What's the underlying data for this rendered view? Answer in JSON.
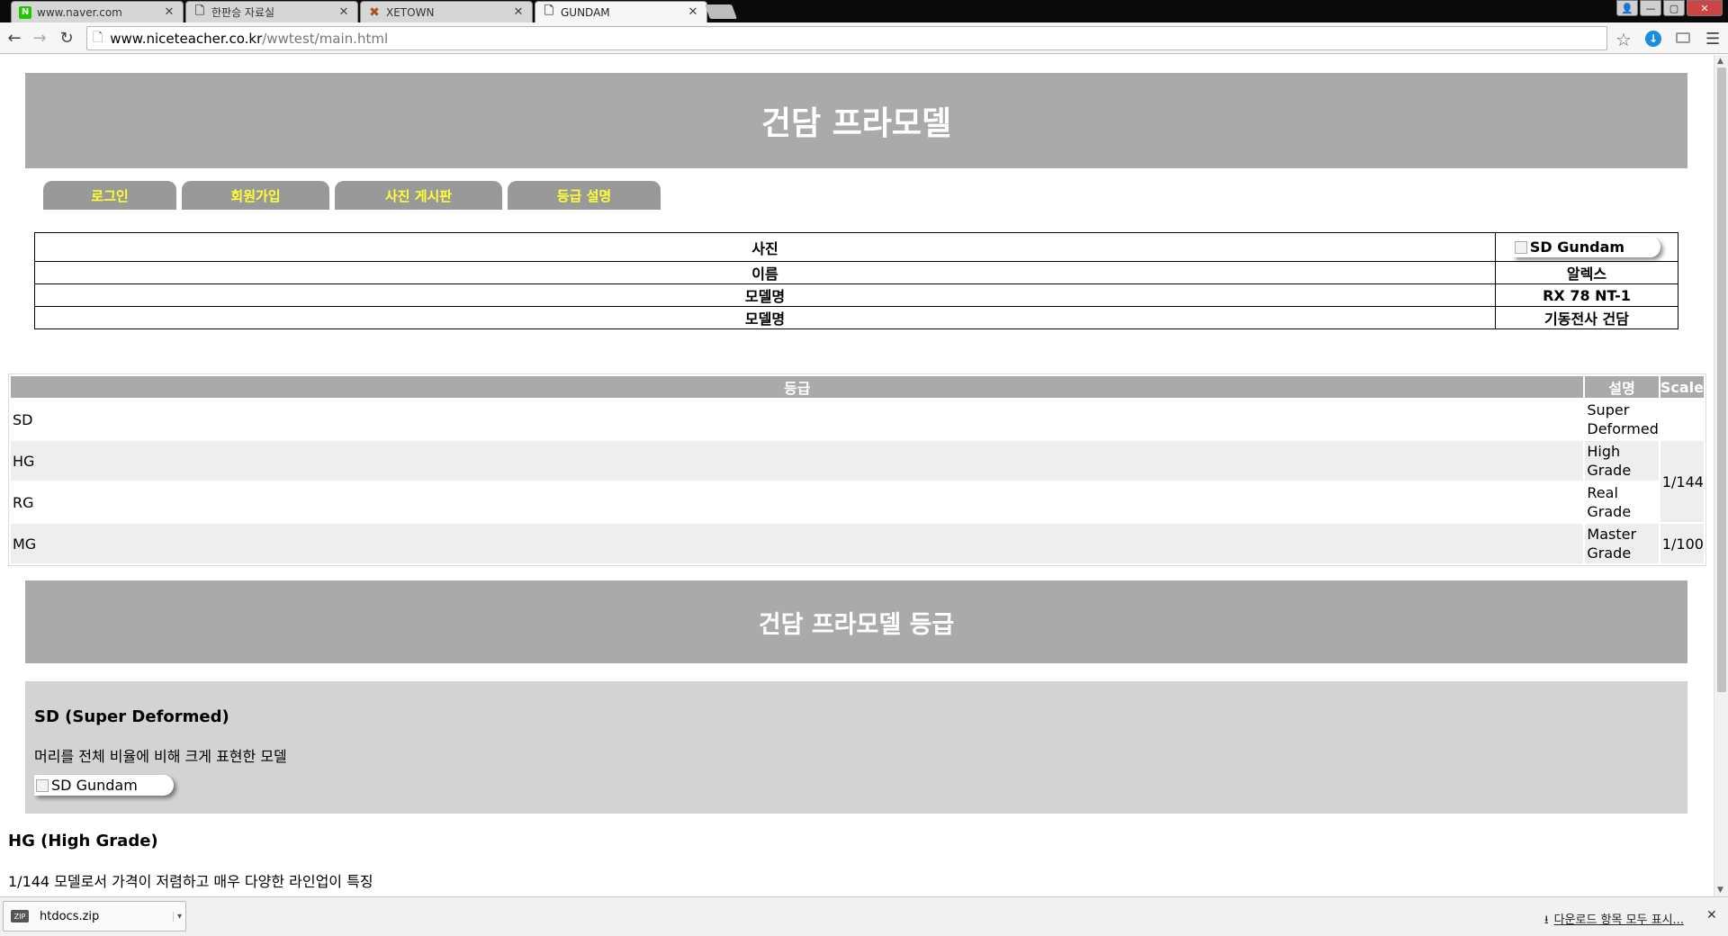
{
  "tabs": [
    {
      "label": "www.naver.com",
      "icon": "naver-favicon"
    },
    {
      "label": "한판승 자료실",
      "icon": "document-favicon"
    },
    {
      "label": "XETOWN",
      "icon": "xetown-favicon"
    },
    {
      "label": "GUNDAM",
      "icon": "document-favicon",
      "active": true
    }
  ],
  "address": {
    "host": "www.niceteacher.co.kr",
    "path": "/wwtest/main.html"
  },
  "page": {
    "title": "건담 프라모델",
    "nav": [
      "로그인",
      "회원가입",
      "사진 게시판",
      "등급 설명"
    ],
    "info": {
      "rows": [
        {
          "label": "사진",
          "value": "SD Gundam"
        },
        {
          "label": "이름",
          "value": "알렉스"
        },
        {
          "label": "모델명",
          "value": "RX 78 NT-1"
        },
        {
          "label": "모델명",
          "value": "기동전사 건담"
        }
      ]
    },
    "grades": {
      "headers": [
        "등급",
        "설명",
        "Scale"
      ],
      "rows": [
        {
          "grade": "SD",
          "desc": "Super Deformed",
          "scale": ""
        },
        {
          "grade": "HG",
          "desc": "High Grade",
          "scale": "1/144"
        },
        {
          "grade": "RG",
          "desc": "Real Grade",
          "scale": ""
        },
        {
          "grade": "MG",
          "desc": "Master Grade",
          "scale": "1/100"
        }
      ]
    },
    "grade_title": "건담 프라모델 등급",
    "sd_section": {
      "heading": "SD (Super Deformed)",
      "text": "머리를 전체 비율에 비해 크게 표현한 모델",
      "image_alt": "SD Gundam"
    },
    "hg_section": {
      "heading": "HG (High Grade)",
      "text": "1/144 모델로서 가격이 저렴하고 매우 다양한 라인업이 특징"
    }
  },
  "downloads": {
    "item": "htdocs.zip",
    "show_all": "다운로드 항목 모두 표시..."
  },
  "colors": {
    "banner": "#aaaaaa",
    "nav_text": "#ffff33",
    "nav_bg": "#999999",
    "section_bg": "#d3d3d3"
  }
}
